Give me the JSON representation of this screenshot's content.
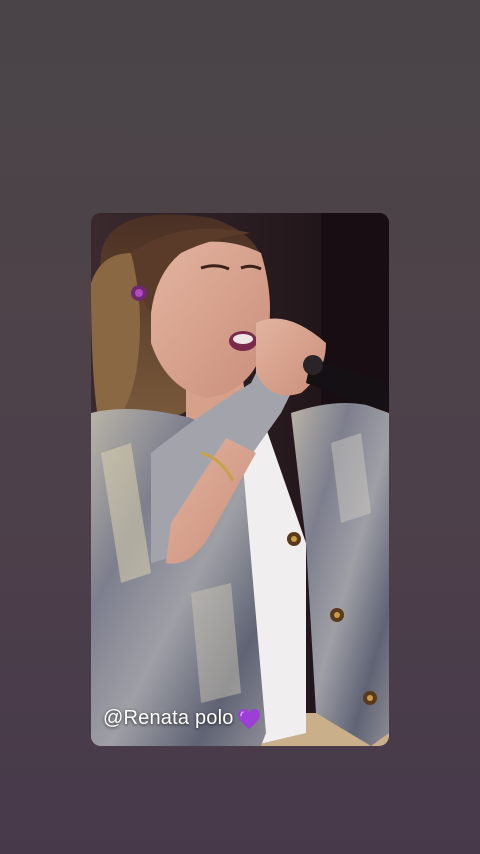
{
  "story": {
    "caption": "@Renata  polo",
    "caption_emoji": "purple-heart-icon"
  },
  "colors": {
    "page_background": "#4c4149",
    "heart": "#9b3fd6"
  }
}
